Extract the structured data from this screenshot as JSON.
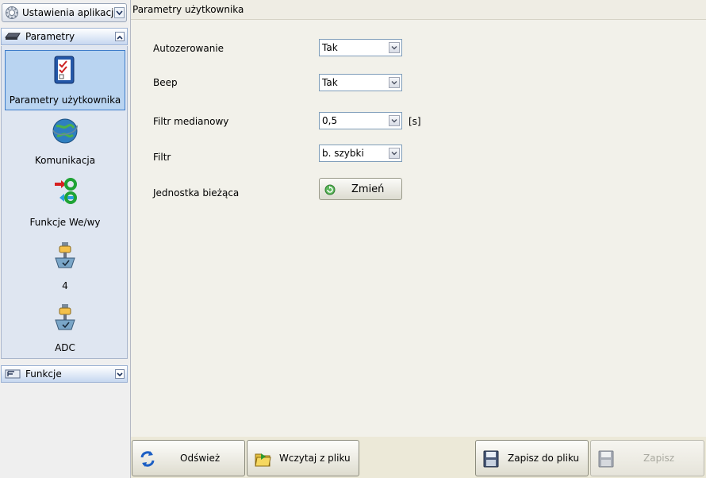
{
  "app_selector": {
    "label": "Ustawienia aplikacji"
  },
  "sidebar": {
    "groups": [
      {
        "label": "Parametry",
        "icon": "chip-icon",
        "expanded": true
      },
      {
        "label": "Funkcje",
        "icon": "function-icon",
        "expanded": false
      }
    ],
    "items": [
      {
        "label": "Parametry użytkownika",
        "icon": "user-parameters-icon",
        "selected": true
      },
      {
        "label": "Komunikacja",
        "icon": "communication-globe-icon",
        "selected": false
      },
      {
        "label": "Funkcje We/wy",
        "icon": "io-functions-icon",
        "selected": false
      },
      {
        "label": "4",
        "icon": "scale-icon",
        "selected": false
      },
      {
        "label": "ADC",
        "icon": "scale-icon",
        "selected": false
      }
    ]
  },
  "main": {
    "title": "Parametry użytkownika",
    "fields": [
      {
        "label": "Autozerowanie",
        "value": "Tak",
        "unit": ""
      },
      {
        "label": "Beep",
        "value": "Tak",
        "unit": ""
      },
      {
        "label": "Filtr medianowy",
        "value": "0,5",
        "unit": "[s]"
      },
      {
        "label": "Filtr",
        "value": "b. szybki",
        "unit": ""
      },
      {
        "label": "Jednostka bieżąca",
        "button": "Zmień"
      }
    ]
  },
  "toolbar": {
    "refresh": "Odśwież",
    "load_file": "Wczytaj z pliku",
    "save_file": "Zapisz do pliku",
    "save": "Zapisz"
  },
  "colors": {
    "accent": "#3d7cc9",
    "selected_bg": "#b9d4f1",
    "disabled_text": "#a9a9a0"
  }
}
